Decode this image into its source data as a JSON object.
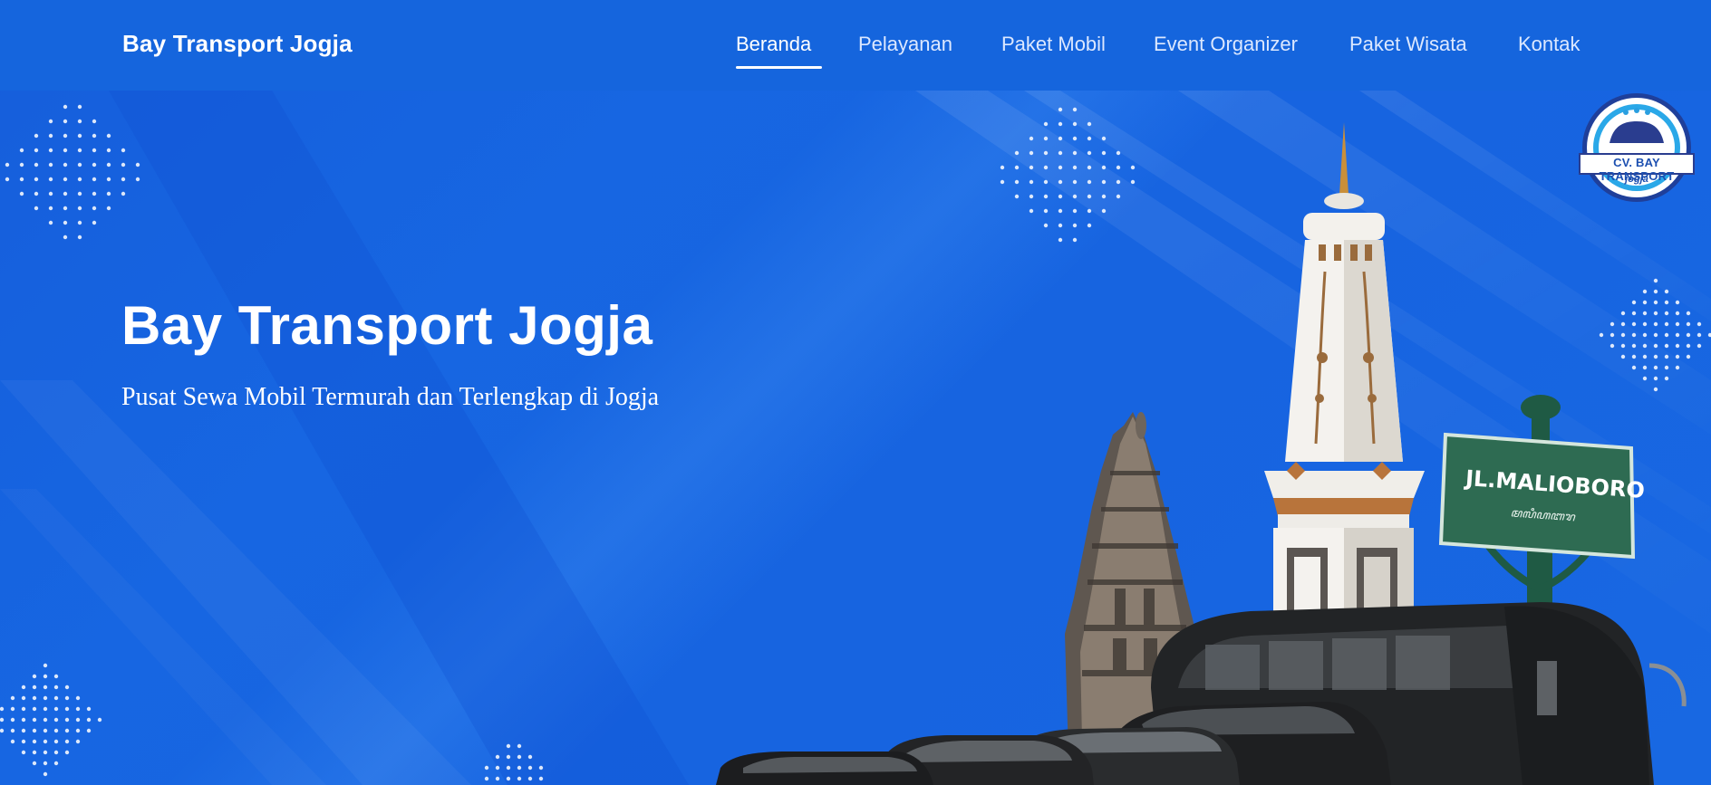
{
  "window": {
    "title": "Bay Transport Jogja"
  },
  "header": {
    "brand": "Bay Transport Jogja",
    "nav": [
      {
        "label": "Beranda",
        "active": true
      },
      {
        "label": "Pelayanan",
        "active": false
      },
      {
        "label": "Paket Mobil",
        "active": false
      },
      {
        "label": "Event Organizer",
        "active": false
      },
      {
        "label": "Paket Wisata",
        "active": false
      },
      {
        "label": "Kontak",
        "active": false
      }
    ]
  },
  "hero": {
    "title": "Bay Transport Jogja",
    "subtitle": "Pusat Sewa Mobil Termurah dan Terlengkap di Jogja",
    "street_sign": "JL.MALIOBORO",
    "street_sign_script": "ꦩꦭꦶꦲꦧꦫ"
  },
  "logo": {
    "name": "CV. BAY TRANSPORT",
    "sub": "jogja"
  },
  "colors": {
    "background": "#1565e0",
    "nav_active": "#ffffff",
    "nav_inactive": "#dce8ff",
    "sign_green": "#2e6b52"
  },
  "icons": [
    "tugu-monument-illustration",
    "prambanan-temple-illustration",
    "car-fleet-illustration",
    "company-logo"
  ]
}
